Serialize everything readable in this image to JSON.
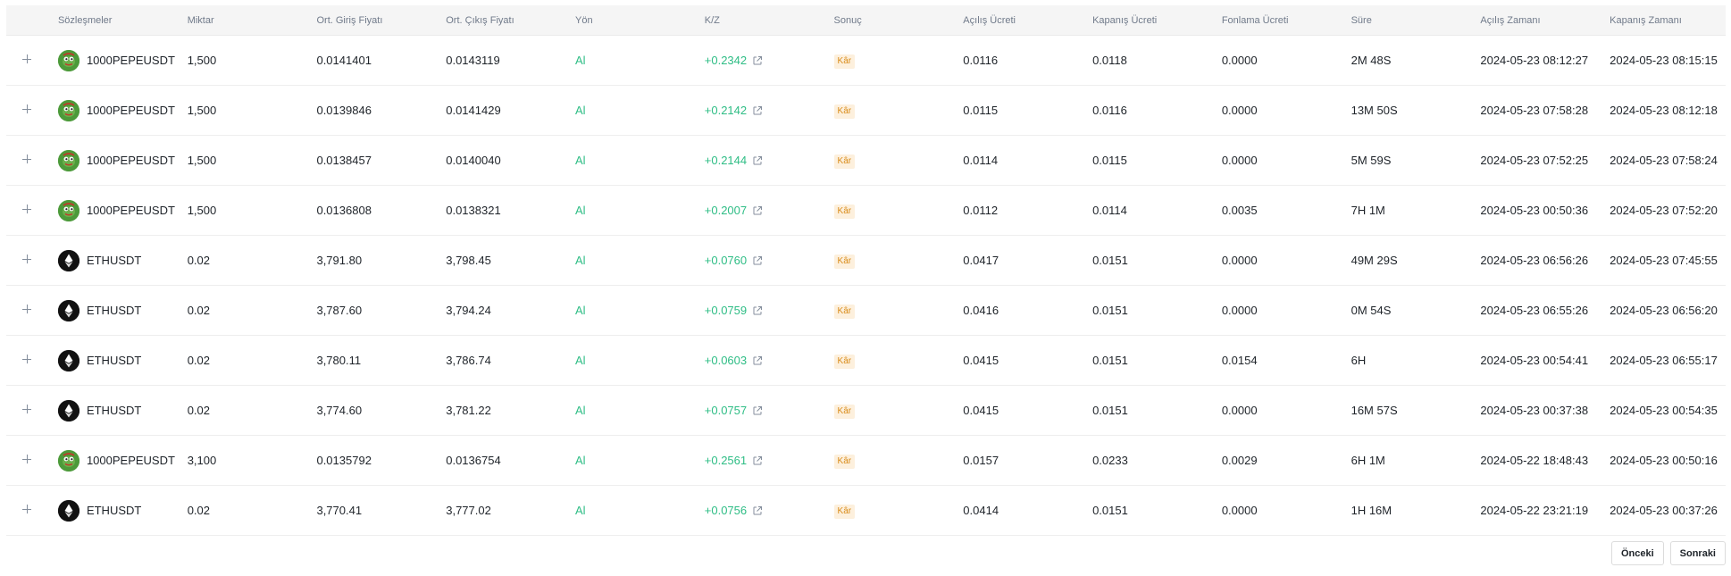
{
  "columns": [
    "Sözleşmeler",
    "Miktar",
    "Ort. Giriş Fiyatı",
    "Ort. Çıkış Fiyatı",
    "Yön",
    "K/Z",
    "Sonuç",
    "Açılış Ücreti",
    "Kapanış Ücreti",
    "Fonlama Ücreti",
    "Süre",
    "Açılış Zamanı",
    "Kapanış Zamanı"
  ],
  "rows": [
    {
      "coin": "pepe",
      "contract": "1000PEPEUSDT",
      "qty": "1,500",
      "entry": "0.0141401",
      "exit": "0.0143119",
      "side": "Al",
      "pnl": "+0.2342",
      "result": "Kâr",
      "open_fee": "0.0116",
      "close_fee": "0.0118",
      "funding": "0.0000",
      "duration": "2M 48S",
      "open_time": "2024-05-23 08:12:27",
      "close_time": "2024-05-23 08:15:15"
    },
    {
      "coin": "pepe",
      "contract": "1000PEPEUSDT",
      "qty": "1,500",
      "entry": "0.0139846",
      "exit": "0.0141429",
      "side": "Al",
      "pnl": "+0.2142",
      "result": "Kâr",
      "open_fee": "0.0115",
      "close_fee": "0.0116",
      "funding": "0.0000",
      "duration": "13M 50S",
      "open_time": "2024-05-23 07:58:28",
      "close_time": "2024-05-23 08:12:18"
    },
    {
      "coin": "pepe",
      "contract": "1000PEPEUSDT",
      "qty": "1,500",
      "entry": "0.0138457",
      "exit": "0.0140040",
      "side": "Al",
      "pnl": "+0.2144",
      "result": "Kâr",
      "open_fee": "0.0114",
      "close_fee": "0.0115",
      "funding": "0.0000",
      "duration": "5M 59S",
      "open_time": "2024-05-23 07:52:25",
      "close_time": "2024-05-23 07:58:24"
    },
    {
      "coin": "pepe",
      "contract": "1000PEPEUSDT",
      "qty": "1,500",
      "entry": "0.0136808",
      "exit": "0.0138321",
      "side": "Al",
      "pnl": "+0.2007",
      "result": "Kâr",
      "open_fee": "0.0112",
      "close_fee": "0.0114",
      "funding": "0.0035",
      "duration": "7H 1M",
      "open_time": "2024-05-23 00:50:36",
      "close_time": "2024-05-23 07:52:20"
    },
    {
      "coin": "eth",
      "contract": "ETHUSDT",
      "qty": "0.02",
      "entry": "3,791.80",
      "exit": "3,798.45",
      "side": "Al",
      "pnl": "+0.0760",
      "result": "Kâr",
      "open_fee": "0.0417",
      "close_fee": "0.0151",
      "funding": "0.0000",
      "duration": "49M 29S",
      "open_time": "2024-05-23 06:56:26",
      "close_time": "2024-05-23 07:45:55"
    },
    {
      "coin": "eth",
      "contract": "ETHUSDT",
      "qty": "0.02",
      "entry": "3,787.60",
      "exit": "3,794.24",
      "side": "Al",
      "pnl": "+0.0759",
      "result": "Kâr",
      "open_fee": "0.0416",
      "close_fee": "0.0151",
      "funding": "0.0000",
      "duration": "0M 54S",
      "open_time": "2024-05-23 06:55:26",
      "close_time": "2024-05-23 06:56:20"
    },
    {
      "coin": "eth",
      "contract": "ETHUSDT",
      "qty": "0.02",
      "entry": "3,780.11",
      "exit": "3,786.74",
      "side": "Al",
      "pnl": "+0.0603",
      "result": "Kâr",
      "open_fee": "0.0415",
      "close_fee": "0.0151",
      "funding": "0.0154",
      "duration": "6H",
      "open_time": "2024-05-23 00:54:41",
      "close_time": "2024-05-23 06:55:17"
    },
    {
      "coin": "eth",
      "contract": "ETHUSDT",
      "qty": "0.02",
      "entry": "3,774.60",
      "exit": "3,781.22",
      "side": "Al",
      "pnl": "+0.0757",
      "result": "Kâr",
      "open_fee": "0.0415",
      "close_fee": "0.0151",
      "funding": "0.0000",
      "duration": "16M 57S",
      "open_time": "2024-05-23 00:37:38",
      "close_time": "2024-05-23 00:54:35"
    },
    {
      "coin": "pepe",
      "contract": "1000PEPEUSDT",
      "qty": "3,100",
      "entry": "0.0135792",
      "exit": "0.0136754",
      "side": "Al",
      "pnl": "+0.2561",
      "result": "Kâr",
      "open_fee": "0.0157",
      "close_fee": "0.0233",
      "funding": "0.0029",
      "duration": "6H 1M",
      "open_time": "2024-05-22 18:48:43",
      "close_time": "2024-05-23 00:50:16"
    },
    {
      "coin": "eth",
      "contract": "ETHUSDT",
      "qty": "0.02",
      "entry": "3,770.41",
      "exit": "3,777.02",
      "side": "Al",
      "pnl": "+0.0756",
      "result": "Kâr",
      "open_fee": "0.0414",
      "close_fee": "0.0151",
      "funding": "0.0000",
      "duration": "1H 16M",
      "open_time": "2024-05-22 23:21:19",
      "close_time": "2024-05-23 00:37:26"
    }
  ],
  "pagination": {
    "prev_label": "Önceki",
    "next_label": "Sonraki"
  },
  "colors": {
    "buy": "#2ebd85",
    "profit_badge_bg": "#fdf0dd",
    "profit_badge_text": "#d98c1a",
    "header_bg": "#f5f5f5"
  },
  "icons": {
    "expand": "plus-icon",
    "pnl_share": "external-link-icon",
    "pepe": "pepe-coin-icon",
    "eth": "eth-coin-icon"
  }
}
